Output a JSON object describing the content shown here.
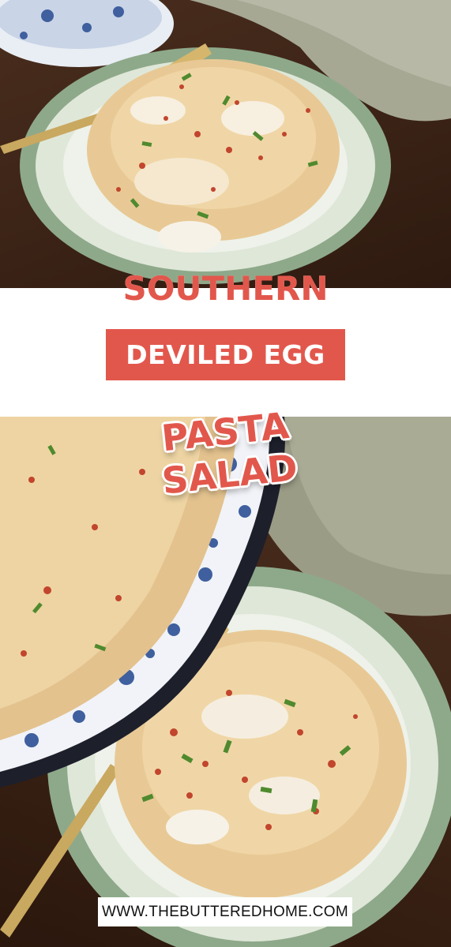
{
  "title": {
    "line1": "SOUTHERN",
    "line2": "DEVILED EGG",
    "line3": "PASTA SALAD"
  },
  "website": "WWW.THEBUTTEREDHOME.COM",
  "colors": {
    "accent": "#e2574c",
    "band": "#ffffff",
    "wood": "#3a2418",
    "plate_rim": "#a9bca6",
    "towel": "#8f917c"
  },
  "photos": {
    "top": "Pasta salad served on a green floral plate with a gold fork",
    "bottom": "Enamel bowl of pasta salad beside a plated serving"
  }
}
